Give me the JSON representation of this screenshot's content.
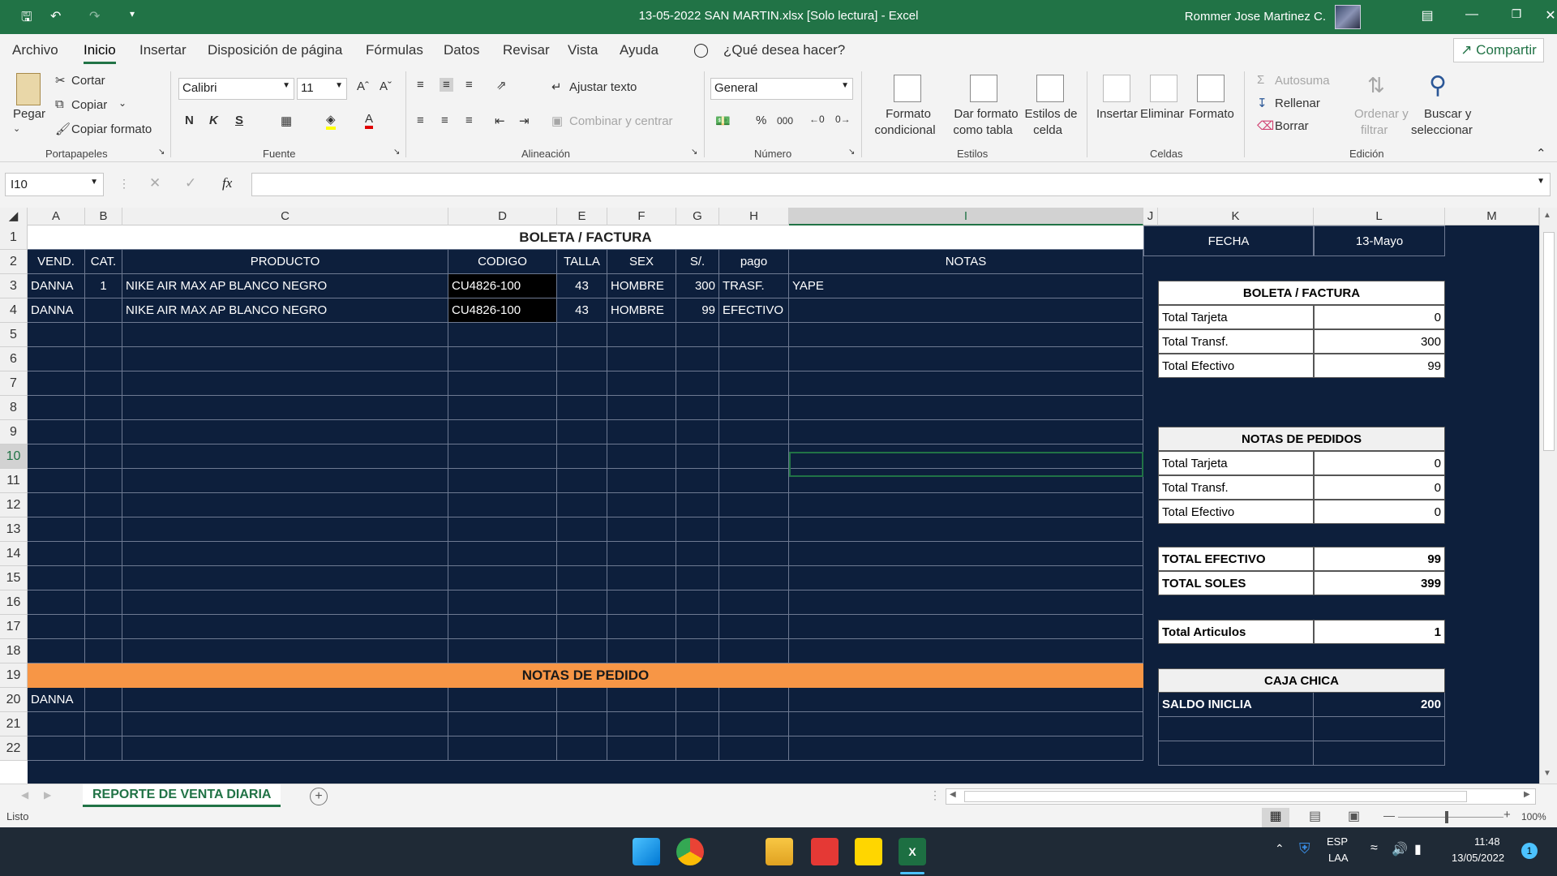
{
  "window": {
    "title": "13-05-2022 SAN MARTIN.xlsx  [Solo lectura]  -  Excel",
    "user": "Rommer Jose Martinez C."
  },
  "menu": [
    "Archivo",
    "Inicio",
    "Insertar",
    "Disposición de página",
    "Fórmulas",
    "Datos",
    "Revisar",
    "Vista",
    "Ayuda"
  ],
  "tellme": "¿Qué desea hacer?",
  "share": "Compartir",
  "ribbon": {
    "pegar": "Pegar",
    "cortar": "Cortar",
    "copiar": "Copiar",
    "copiar_formato": "Copiar formato",
    "portapapeles": "Portapapeles",
    "font_name": "Calibri",
    "font_size": "11",
    "bold": "N",
    "italic": "K",
    "underline": "S",
    "fuente": "Fuente",
    "ajustar": "Ajustar texto",
    "combinar": "Combinar y centrar",
    "alineacion": "Alineación",
    "numfmt": "General",
    "numero": "Número",
    "formato_cond_1": "Formato",
    "formato_cond_2": "condicional",
    "dar_formato_1": "Dar formato",
    "dar_formato_2": "como tabla",
    "estilos_celda_1": "Estilos de",
    "estilos_celda_2": "celda",
    "estilos": "Estilos",
    "insertar": "Insertar",
    "eliminar": "Eliminar",
    "formato": "Formato",
    "celdas": "Celdas",
    "autosuma": "Autosuma",
    "rellenar": "Rellenar",
    "borrar": "Borrar",
    "ordenar_1": "Ordenar y",
    "ordenar_2": "filtrar",
    "buscar_1": "Buscar y",
    "buscar_2": "seleccionar",
    "edicion": "Edición"
  },
  "formula_bar": {
    "name_box": "I10",
    "fx": "fx",
    "formula": ""
  },
  "columns": [
    "A",
    "B",
    "C",
    "D",
    "E",
    "F",
    "G",
    "H",
    "I",
    "J",
    "K",
    "L",
    "M"
  ],
  "rows": [
    "1",
    "2",
    "3",
    "4",
    "5",
    "6",
    "7",
    "8",
    "9",
    "10",
    "11",
    "12",
    "13",
    "14",
    "15",
    "16",
    "17",
    "18",
    "19",
    "20",
    "21",
    "22"
  ],
  "sheet": {
    "title": "BOLETA / FACTURA",
    "headers": [
      "VEND.",
      "CAT.",
      "PRODUCTO",
      "CODIGO",
      "TALLA",
      "SEX",
      "S/.",
      "pago",
      "NOTAS"
    ],
    "rows": [
      [
        "DANNA",
        "1",
        "NIKE AIR MAX AP BLANCO NEGRO",
        "CU4826-100",
        "43",
        "HOMBRE",
        "300",
        "TRASF.",
        "YAPE"
      ],
      [
        "DANNA",
        "",
        "NIKE AIR MAX AP BLANCO NEGRO",
        "CU4826-100",
        "43",
        "HOMBRE",
        "99",
        "EFECTIVO",
        ""
      ]
    ],
    "notas_pedido_title": "NOTAS DE PEDIDO",
    "notas_row": [
      "DANNA"
    ]
  },
  "summary": {
    "fecha_label": "FECHA",
    "fecha_value": "13-Mayo",
    "boleta_title": "BOLETA / FACTURA",
    "boleta": [
      [
        "Total Tarjeta",
        "0"
      ],
      [
        "Total Transf.",
        "300"
      ],
      [
        "Total Efectivo",
        "99"
      ]
    ],
    "notas_title": "NOTAS DE PEDIDOS",
    "notas": [
      [
        "Total Tarjeta",
        "0"
      ],
      [
        "Total Transf.",
        "0"
      ],
      [
        "Total Efectivo",
        "0"
      ]
    ],
    "totales": [
      [
        "TOTAL EFECTIVO",
        "99"
      ],
      [
        "TOTAL SOLES",
        "399"
      ]
    ],
    "articulos": [
      "Total Articulos",
      "1"
    ],
    "caja_title": "CAJA CHICA",
    "caja": [
      "SALDO INICLIA",
      "200"
    ]
  },
  "sheet_tab": "REPORTE DE VENTA DIARIA",
  "status": {
    "ready": "Listo",
    "zoom": "100%"
  },
  "taskbar": {
    "lang1": "ESP",
    "lang2": "LAA",
    "time": "11:48",
    "date": "13/05/2022",
    "badge": "1"
  }
}
